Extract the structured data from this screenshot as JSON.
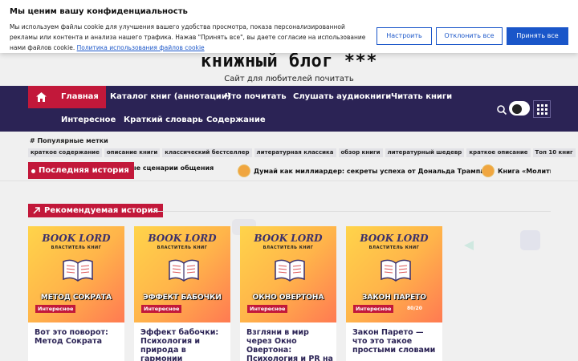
{
  "cookie": {
    "title": "Мы ценим вашу конфиденциальность",
    "text": "Мы используем файлы cookie для улучшения вашего удобства просмотра, показа персонализированной рекламы или контента и анализа нашего трафика. Нажав \"Принять все\", вы даете согласие на использование нами файлов cookie.",
    "link": "Политика использования файлов cookie",
    "customize": "Настроить",
    "reject": "Отклонить все",
    "accept": "Принять все"
  },
  "site": {
    "title": "книжный блог ***",
    "subtitle": "Сайт для любителей почитать"
  },
  "nav": {
    "home_icon": "home-icon",
    "items": [
      "Главная",
      "Каталог книг (аннотации)",
      "Что почитать",
      "Слушать аудиокниги",
      "Читать книги",
      "Интересное",
      "Краткий словарь",
      "Содержание"
    ]
  },
  "tags": {
    "title": "# Популярные метки",
    "items": [
      "краткое содержание",
      "описание книги",
      "классический бестселлер",
      "литературная классика",
      "обзор книги",
      "литературный шедевр",
      "краткое описание",
      "Топ 10 книг"
    ]
  },
  "ticker": {
    "label": "Последняя история",
    "items": [
      "ызные сценарии общения",
      "Думай как миллиардер: секреты успеха от Дональда Трампа",
      "Книга «Молитвы"
    ]
  },
  "featured": {
    "heading": "Рекомендуемая история",
    "cards": [
      {
        "brand": "BOOK LORD",
        "brand_sub": "ВЛАСТИТЕЛЬ КНИГ",
        "cover_title": "МЕТОД СОКРАТА",
        "tag": "Интересное",
        "title": "Вот это поворот: Метод Сократа"
      },
      {
        "brand": "BOOK LORD",
        "brand_sub": "ВЛАСТИТЕЛЬ КНИГ",
        "cover_title": "ЭФФЕКТ БАБОЧКИ",
        "tag": "Интересное",
        "title": "Эффект бабочки: Психология и природа в гармонии"
      },
      {
        "brand": "BOOK LORD",
        "brand_sub": "ВЛАСТИТЕЛЬ КНИГ",
        "cover_title": "ОКНО ОВЕРТОНА",
        "tag": "Интересное",
        "title": "Взгляни в мир через Окно Овертона: Психология и PR на перекрестке"
      },
      {
        "brand": "BOOK LORD",
        "brand_sub": "ВЛАСТИТЕЛЬ КНИГ",
        "cover_title": "ЗАКОН ПАРЕТО",
        "cover_extra": "80/20",
        "tag": "Интересное",
        "title": "Закон Парето — что это такое простыми словами"
      }
    ]
  },
  "colors": {
    "nav_bg": "#2b2355",
    "accent": "#c2183a",
    "link": "#1a56c9"
  }
}
